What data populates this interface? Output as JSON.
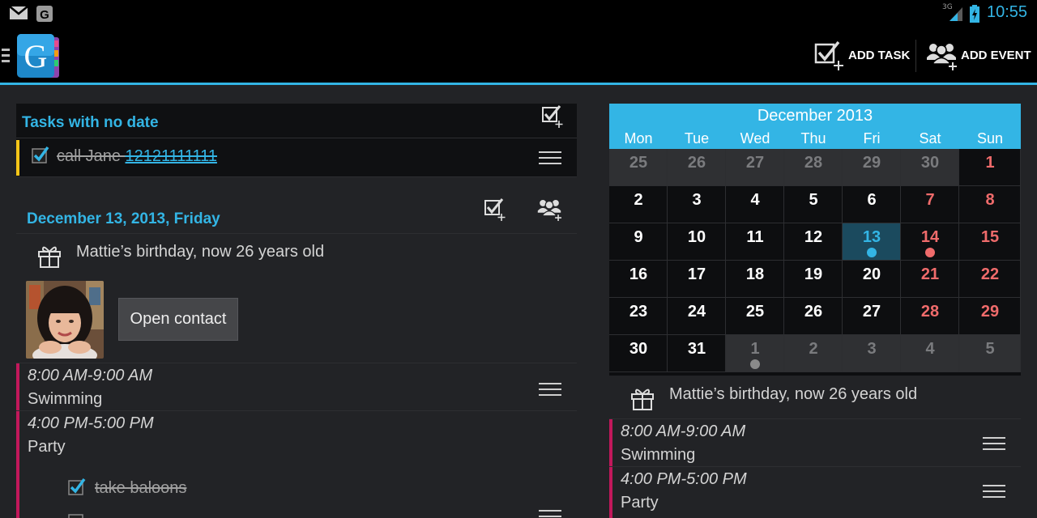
{
  "status": {
    "network": "3G",
    "time": "10:55"
  },
  "actionbar": {
    "logo_letter": "G",
    "add_task_label": "ADD TASK",
    "add_event_label": "ADD EVENT"
  },
  "left": {
    "no_date_title": "Tasks with no date",
    "no_date_task": {
      "text": "call Jane ",
      "phone": "12121111111",
      "done": true,
      "accent": "#f5c518"
    },
    "day_title": "December 13, 2013, Friday",
    "birthday_text": "Mattie’s birthday, now 26 years old",
    "open_contact_label": "Open contact",
    "events": [
      {
        "time": "8:00 AM-9:00 AM",
        "name": "Swimming",
        "accent": "#c2185b"
      },
      {
        "time": "4:00 PM-5:00 PM",
        "name": "Party",
        "accent": "#c2185b"
      }
    ],
    "subtasks": [
      {
        "text": "take baloons",
        "done": true
      }
    ]
  },
  "calendar": {
    "month": "December 2013",
    "dow": [
      "Mon",
      "Tue",
      "Wed",
      "Thu",
      "Fri",
      "Sat",
      "Sun"
    ],
    "weeks": [
      [
        {
          "d": "25",
          "m": "other"
        },
        {
          "d": "26",
          "m": "other"
        },
        {
          "d": "27",
          "m": "other"
        },
        {
          "d": "28",
          "m": "other"
        },
        {
          "d": "29",
          "m": "other"
        },
        {
          "d": "30",
          "m": "other"
        },
        {
          "d": "1",
          "m": "weekend"
        }
      ],
      [
        {
          "d": "2"
        },
        {
          "d": "3"
        },
        {
          "d": "4"
        },
        {
          "d": "5"
        },
        {
          "d": "6"
        },
        {
          "d": "7",
          "m": "weekend"
        },
        {
          "d": "8",
          "m": "weekend"
        }
      ],
      [
        {
          "d": "9"
        },
        {
          "d": "10"
        },
        {
          "d": "11"
        },
        {
          "d": "12"
        },
        {
          "d": "13",
          "m": "today",
          "dot": "#33b5e5"
        },
        {
          "d": "14",
          "m": "weekend",
          "dot": "#ef6b6b"
        },
        {
          "d": "15",
          "m": "weekend"
        }
      ],
      [
        {
          "d": "16"
        },
        {
          "d": "17"
        },
        {
          "d": "18"
        },
        {
          "d": "19"
        },
        {
          "d": "20"
        },
        {
          "d": "21",
          "m": "weekend"
        },
        {
          "d": "22",
          "m": "weekend"
        }
      ],
      [
        {
          "d": "23"
        },
        {
          "d": "24"
        },
        {
          "d": "25"
        },
        {
          "d": "26"
        },
        {
          "d": "27"
        },
        {
          "d": "28",
          "m": "weekend"
        },
        {
          "d": "29",
          "m": "weekend"
        }
      ],
      [
        {
          "d": "30"
        },
        {
          "d": "31"
        },
        {
          "d": "1",
          "m": "other",
          "dot": "#8a8a8a"
        },
        {
          "d": "2",
          "m": "other"
        },
        {
          "d": "3",
          "m": "other"
        },
        {
          "d": "4",
          "m": "other"
        },
        {
          "d": "5",
          "m": "other"
        }
      ]
    ],
    "colors": {
      "header": "#33b5e5",
      "weekend": "#ef6b6b",
      "today": "#33b5e5",
      "other": "#7a7b7e"
    }
  },
  "right": {
    "birthday_text": "Mattie’s birthday, now 26 years old",
    "events": [
      {
        "time": "8:00 AM-9:00 AM",
        "name": "Swimming",
        "accent": "#c2185b"
      },
      {
        "time": "4:00 PM-5:00 PM",
        "name": "Party",
        "accent": "#c2185b"
      }
    ]
  }
}
